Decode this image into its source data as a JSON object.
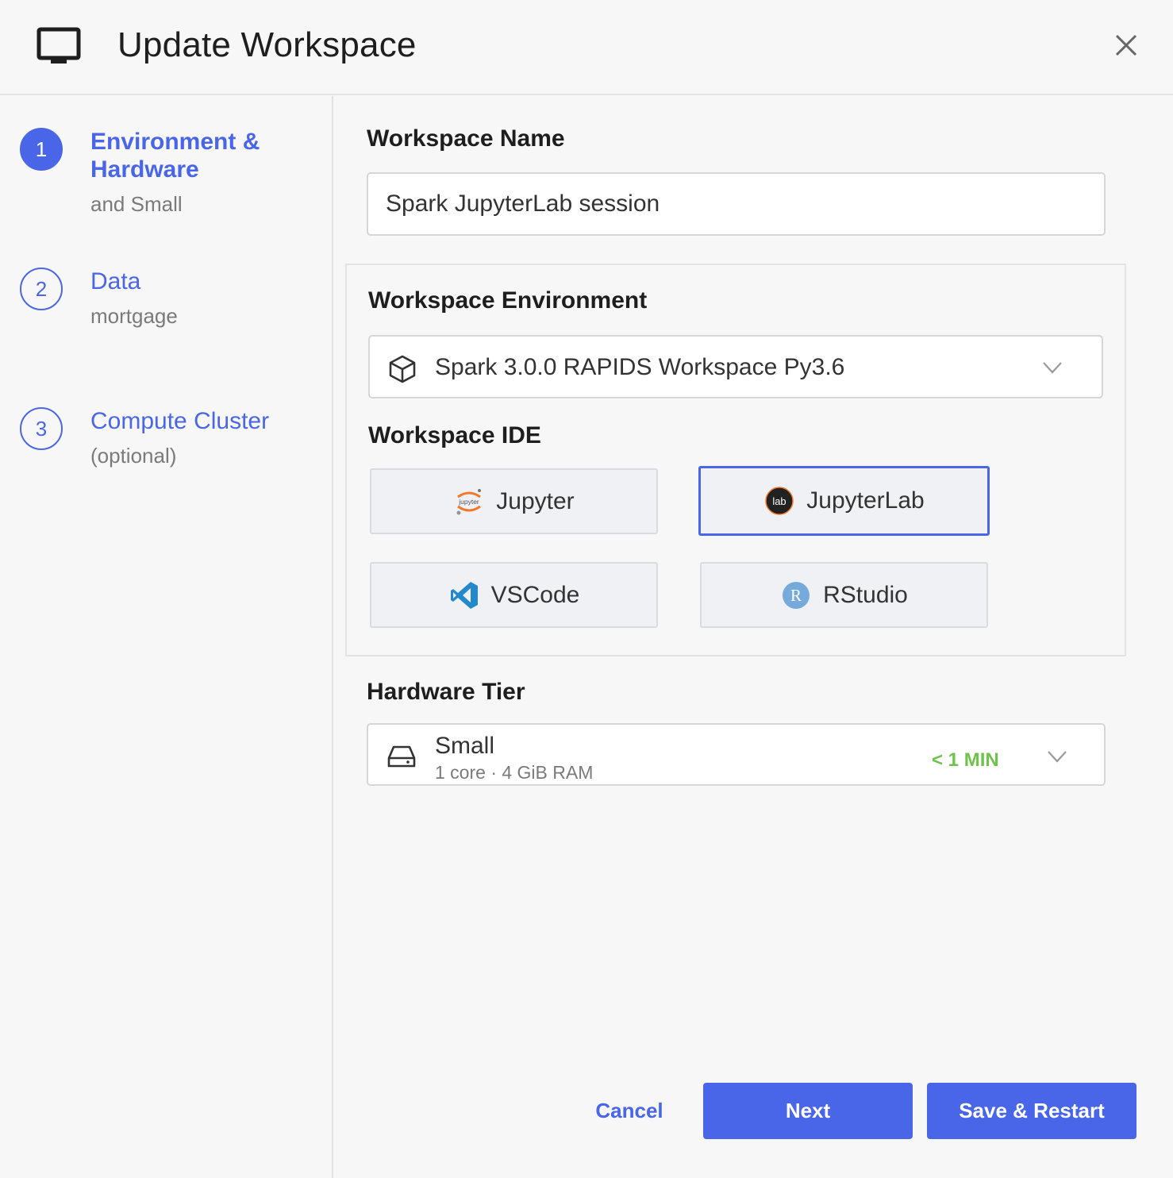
{
  "header": {
    "title": "Update Workspace",
    "icon": "monitor-icon",
    "close_icon": "close-icon"
  },
  "steps": [
    {
      "number": "1",
      "title": "Environment & Hardware",
      "subtitle": "and Small",
      "active": true
    },
    {
      "number": "2",
      "title": "Data",
      "subtitle": "mortgage",
      "active": false
    },
    {
      "number": "3",
      "title": "Compute Cluster",
      "subtitle": "(optional)",
      "active": false
    }
  ],
  "workspace_name": {
    "label": "Workspace Name",
    "value": "Spark JupyterLab session"
  },
  "environment": {
    "label": "Workspace Environment",
    "selected": "Spark 3.0.0 RAPIDS Workspace Py3.6",
    "icon": "cube-icon"
  },
  "ide": {
    "label": "Workspace IDE",
    "options": [
      {
        "label": "Jupyter",
        "icon": "jupyter-icon",
        "selected": false
      },
      {
        "label": "JupyterLab",
        "icon": "jupyterlab-icon",
        "selected": true
      },
      {
        "label": "VSCode",
        "icon": "vscode-icon",
        "selected": false
      },
      {
        "label": "RStudio",
        "icon": "rstudio-icon",
        "selected": false
      }
    ]
  },
  "hardware": {
    "label": "Hardware Tier",
    "name": "Small",
    "details": "1 core · 4 GiB RAM",
    "startup": "< 1 MIN",
    "icon": "hard-drive-icon"
  },
  "footer": {
    "cancel": "Cancel",
    "next": "Next",
    "save": "Save & Restart"
  },
  "colors": {
    "accent": "#4a66e8",
    "success": "#6fc24a",
    "background": "#f7f7f7"
  }
}
